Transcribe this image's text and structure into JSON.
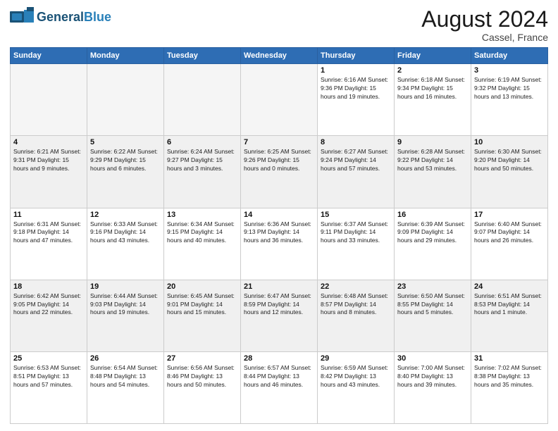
{
  "header": {
    "logo_line1": "General",
    "logo_line2": "Blue",
    "month_title": "August 2024",
    "location": "Cassel, France"
  },
  "weekdays": [
    "Sunday",
    "Monday",
    "Tuesday",
    "Wednesday",
    "Thursday",
    "Friday",
    "Saturday"
  ],
  "weeks": [
    [
      {
        "day": "",
        "info": "",
        "empty": true
      },
      {
        "day": "",
        "info": "",
        "empty": true
      },
      {
        "day": "",
        "info": "",
        "empty": true
      },
      {
        "day": "",
        "info": "",
        "empty": true
      },
      {
        "day": "1",
        "info": "Sunrise: 6:16 AM\nSunset: 9:36 PM\nDaylight: 15 hours\nand 19 minutes."
      },
      {
        "day": "2",
        "info": "Sunrise: 6:18 AM\nSunset: 9:34 PM\nDaylight: 15 hours\nand 16 minutes."
      },
      {
        "day": "3",
        "info": "Sunrise: 6:19 AM\nSunset: 9:32 PM\nDaylight: 15 hours\nand 13 minutes."
      }
    ],
    [
      {
        "day": "4",
        "info": "Sunrise: 6:21 AM\nSunset: 9:31 PM\nDaylight: 15 hours\nand 9 minutes."
      },
      {
        "day": "5",
        "info": "Sunrise: 6:22 AM\nSunset: 9:29 PM\nDaylight: 15 hours\nand 6 minutes."
      },
      {
        "day": "6",
        "info": "Sunrise: 6:24 AM\nSunset: 9:27 PM\nDaylight: 15 hours\nand 3 minutes."
      },
      {
        "day": "7",
        "info": "Sunrise: 6:25 AM\nSunset: 9:26 PM\nDaylight: 15 hours\nand 0 minutes."
      },
      {
        "day": "8",
        "info": "Sunrise: 6:27 AM\nSunset: 9:24 PM\nDaylight: 14 hours\nand 57 minutes."
      },
      {
        "day": "9",
        "info": "Sunrise: 6:28 AM\nSunset: 9:22 PM\nDaylight: 14 hours\nand 53 minutes."
      },
      {
        "day": "10",
        "info": "Sunrise: 6:30 AM\nSunset: 9:20 PM\nDaylight: 14 hours\nand 50 minutes."
      }
    ],
    [
      {
        "day": "11",
        "info": "Sunrise: 6:31 AM\nSunset: 9:18 PM\nDaylight: 14 hours\nand 47 minutes."
      },
      {
        "day": "12",
        "info": "Sunrise: 6:33 AM\nSunset: 9:16 PM\nDaylight: 14 hours\nand 43 minutes."
      },
      {
        "day": "13",
        "info": "Sunrise: 6:34 AM\nSunset: 9:15 PM\nDaylight: 14 hours\nand 40 minutes."
      },
      {
        "day": "14",
        "info": "Sunrise: 6:36 AM\nSunset: 9:13 PM\nDaylight: 14 hours\nand 36 minutes."
      },
      {
        "day": "15",
        "info": "Sunrise: 6:37 AM\nSunset: 9:11 PM\nDaylight: 14 hours\nand 33 minutes."
      },
      {
        "day": "16",
        "info": "Sunrise: 6:39 AM\nSunset: 9:09 PM\nDaylight: 14 hours\nand 29 minutes."
      },
      {
        "day": "17",
        "info": "Sunrise: 6:40 AM\nSunset: 9:07 PM\nDaylight: 14 hours\nand 26 minutes."
      }
    ],
    [
      {
        "day": "18",
        "info": "Sunrise: 6:42 AM\nSunset: 9:05 PM\nDaylight: 14 hours\nand 22 minutes."
      },
      {
        "day": "19",
        "info": "Sunrise: 6:44 AM\nSunset: 9:03 PM\nDaylight: 14 hours\nand 19 minutes."
      },
      {
        "day": "20",
        "info": "Sunrise: 6:45 AM\nSunset: 9:01 PM\nDaylight: 14 hours\nand 15 minutes."
      },
      {
        "day": "21",
        "info": "Sunrise: 6:47 AM\nSunset: 8:59 PM\nDaylight: 14 hours\nand 12 minutes."
      },
      {
        "day": "22",
        "info": "Sunrise: 6:48 AM\nSunset: 8:57 PM\nDaylight: 14 hours\nand 8 minutes."
      },
      {
        "day": "23",
        "info": "Sunrise: 6:50 AM\nSunset: 8:55 PM\nDaylight: 14 hours\nand 5 minutes."
      },
      {
        "day": "24",
        "info": "Sunrise: 6:51 AM\nSunset: 8:53 PM\nDaylight: 14 hours\nand 1 minute."
      }
    ],
    [
      {
        "day": "25",
        "info": "Sunrise: 6:53 AM\nSunset: 8:51 PM\nDaylight: 13 hours\nand 57 minutes."
      },
      {
        "day": "26",
        "info": "Sunrise: 6:54 AM\nSunset: 8:48 PM\nDaylight: 13 hours\nand 54 minutes."
      },
      {
        "day": "27",
        "info": "Sunrise: 6:56 AM\nSunset: 8:46 PM\nDaylight: 13 hours\nand 50 minutes."
      },
      {
        "day": "28",
        "info": "Sunrise: 6:57 AM\nSunset: 8:44 PM\nDaylight: 13 hours\nand 46 minutes."
      },
      {
        "day": "29",
        "info": "Sunrise: 6:59 AM\nSunset: 8:42 PM\nDaylight: 13 hours\nand 43 minutes."
      },
      {
        "day": "30",
        "info": "Sunrise: 7:00 AM\nSunset: 8:40 PM\nDaylight: 13 hours\nand 39 minutes."
      },
      {
        "day": "31",
        "info": "Sunrise: 7:02 AM\nSunset: 8:38 PM\nDaylight: 13 hours\nand 35 minutes."
      }
    ]
  ]
}
